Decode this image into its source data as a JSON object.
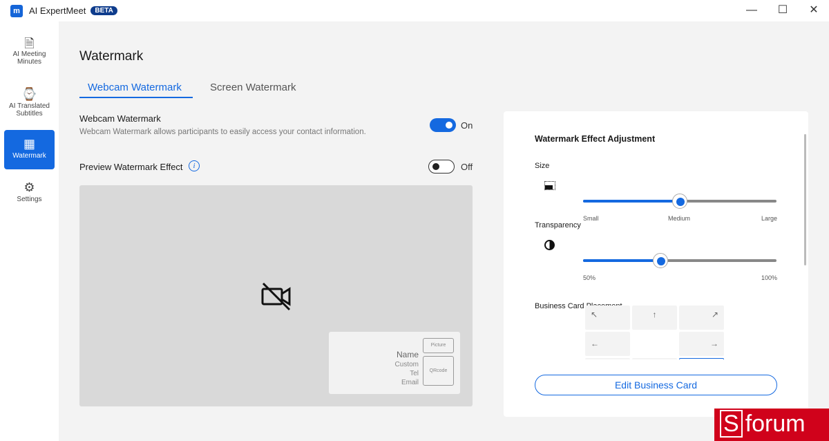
{
  "app": {
    "logo_text": "m",
    "title": "AI ExpertMeet",
    "badge": "BETA",
    "controls": {
      "minimize": "—",
      "maximize": "☐",
      "close": "✕"
    }
  },
  "sidebar": {
    "items": [
      {
        "label": "AI Meeting Minutes",
        "icon": "document-mic-icon",
        "glyph": "🗎"
      },
      {
        "label": "AI Translated Subtitles",
        "icon": "screen-clock-icon",
        "glyph": "⌚"
      },
      {
        "label": "Watermark",
        "icon": "watermark-screen-icon",
        "glyph": "▦",
        "active": true
      },
      {
        "label": "Settings",
        "icon": "gear-icon",
        "glyph": "⚙"
      }
    ]
  },
  "main": {
    "title": "Watermark",
    "tabs": [
      {
        "label": "Webcam Watermark",
        "active": true
      },
      {
        "label": "Screen Watermark"
      }
    ],
    "webcam": {
      "title": "Webcam Watermark",
      "description": "Webcam Watermark allows participants to easily access your contact information.",
      "toggle": true,
      "toggle_label": "On"
    },
    "preview": {
      "title": "Preview Watermark Effect",
      "info": "i",
      "toggle": false,
      "toggle_label": "Off",
      "camera_off_glyph": "⊘",
      "card": {
        "name": "Name",
        "custom": "Custom",
        "tel": "Tel",
        "email": "Email",
        "picture": "Picture",
        "qrcode": "QRcode"
      }
    }
  },
  "panel": {
    "title": "Watermark Effect Adjustment",
    "size": {
      "label": "Size",
      "value_percent": 50,
      "min_label": "Small",
      "mid_label": "Medium",
      "max_label": "Large"
    },
    "transparency": {
      "label": "Transparency",
      "value": 70,
      "min_label": "50%",
      "max_label": "100%"
    },
    "placement": {
      "label": "Business Card Placement",
      "arrows": [
        "↖",
        "↑",
        "↗",
        "←",
        "→"
      ],
      "selected": "bottom-right"
    },
    "edit_button": "Edit Business Card"
  },
  "watermark_logo": "Sforum"
}
